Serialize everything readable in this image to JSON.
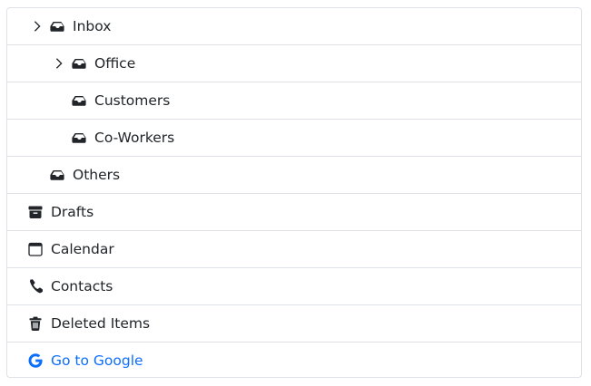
{
  "tree": {
    "items": [
      {
        "label": "Inbox",
        "icon": "inbox-icon",
        "expandable": true
      },
      {
        "label": "Office",
        "icon": "inbox-icon",
        "expandable": true
      },
      {
        "label": "Customers",
        "icon": "inbox-icon",
        "expandable": false
      },
      {
        "label": "Co-Workers",
        "icon": "inbox-icon",
        "expandable": false
      },
      {
        "label": "Others",
        "icon": "inbox-icon",
        "expandable": false
      },
      {
        "label": "Drafts",
        "icon": "archive-icon",
        "expandable": false
      },
      {
        "label": "Calendar",
        "icon": "calendar-icon",
        "expandable": false
      },
      {
        "label": "Contacts",
        "icon": "phone-icon",
        "expandable": false
      },
      {
        "label": "Deleted Items",
        "icon": "trash-icon",
        "expandable": false
      },
      {
        "label": "Go to Google",
        "icon": "google-icon",
        "expandable": false,
        "link": true
      }
    ]
  },
  "colors": {
    "text": "#212529",
    "border": "#dee2e6",
    "link": "#0d6efd"
  }
}
